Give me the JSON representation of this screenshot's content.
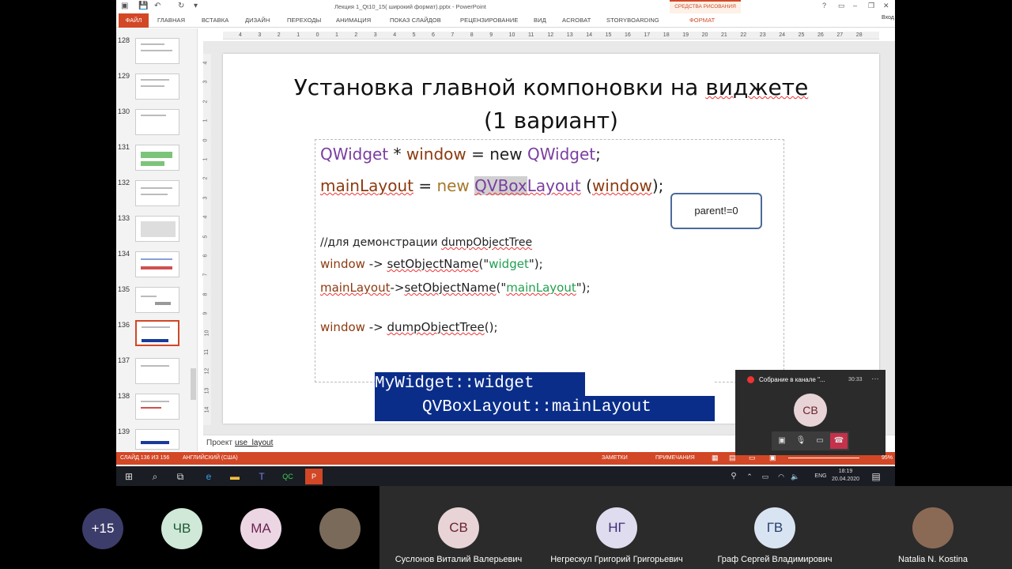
{
  "window": {
    "doc_title": "Лекция 1_Qt10_15( широкий формат).pptx - PowerPoint",
    "tools_header": "СРЕДСТВА РИСОВАНИЯ",
    "login": "Вход"
  },
  "ribbon": {
    "tabs": [
      "ФАЙЛ",
      "ГЛАВНАЯ",
      "ВСТАВКА",
      "ДИЗАЙН",
      "ПЕРЕХОДЫ",
      "АНИМАЦИЯ",
      "ПОКАЗ СЛАЙДОВ",
      "РЕЦЕНЗИРОВАНИЕ",
      "ВИД",
      "ACROBAT",
      "STORYBOARDING",
      "ФОРМАТ"
    ]
  },
  "ruler": {
    "numbers": [
      "4",
      "3",
      "2",
      "1",
      "0",
      "1",
      "2",
      "3",
      "4",
      "5",
      "6",
      "7",
      "8",
      "9",
      "10",
      "11",
      "12",
      "13",
      "14",
      "15",
      "16",
      "17",
      "18",
      "19",
      "20",
      "21",
      "22",
      "23",
      "24",
      "25",
      "26",
      "27",
      "28"
    ],
    "vnumbers": [
      "4",
      "3",
      "2",
      "1",
      "0",
      "1",
      "2",
      "3",
      "4",
      "5",
      "6",
      "7",
      "8",
      "9",
      "10",
      "11",
      "12",
      "13",
      "14"
    ]
  },
  "thumbnails": [
    {
      "num": "128"
    },
    {
      "num": "129"
    },
    {
      "num": "130"
    },
    {
      "num": "131"
    },
    {
      "num": "132"
    },
    {
      "num": "133"
    },
    {
      "num": "134"
    },
    {
      "num": "135"
    },
    {
      "num": "136"
    },
    {
      "num": "137"
    },
    {
      "num": "138"
    },
    {
      "num": "139"
    }
  ],
  "slide": {
    "title_part1": "Установка главной компоновки на ",
    "title_spell": "виджете",
    "title_line2": "(1 вариант)",
    "line1": {
      "a": "QWidget",
      "b": " * ",
      "c": "window",
      "d": " = new ",
      "e": "QWidget",
      "f": ";"
    },
    "line2": {
      "a": "mainLayout",
      "b": " =  ",
      "c": "new ",
      "d": "QVBox",
      "e": "Layout",
      "f": " (",
      "g": "window",
      "h": ");"
    },
    "callout": "parent!=0",
    "comment_a": "//для демонстрации ",
    "comment_b": "dumpObjectTree",
    "line3": {
      "a": "window",
      "b": " -> ",
      "c": "setObjectName",
      "d": "(\"",
      "e": "widget",
      "f": "\");"
    },
    "line4": {
      "a": "mainLayout",
      "b": "->",
      "c": "setObjectName",
      "d": "(\"",
      "e": "mainLayout",
      "f": "\");"
    },
    "line5": {
      "a": "window",
      "b": " -> ",
      "c": "dumpObjectTree",
      "d": "();"
    },
    "output_line1": "MyWidget::widget",
    "output_line2": "QVBoxLayout::mainLayout"
  },
  "notes": {
    "prefix": "Проект ",
    "link": "use_layout"
  },
  "status": {
    "slide": "СЛАЙД 136 ИЗ 156",
    "lang": "АНГЛИЙСКИЙ (США)",
    "notes": "ЗАМЕТКИ",
    "comments": "ПРИМЕЧАНИЯ",
    "zoom": "95%"
  },
  "taskbar": {
    "lang": "ENG",
    "time": "18:19",
    "date": "20.04.2020"
  },
  "mini_meeting": {
    "title": "Собрание в канале \"...",
    "time": "30:33",
    "avatar": "СВ"
  },
  "participants": [
    {
      "initials": "+15",
      "name": "",
      "bg": "#3d3d6b",
      "fg": "#ffffff"
    },
    {
      "initials": "ЧВ",
      "name": "",
      "bg": "#cfe8d8",
      "fg": "#1e5a36"
    },
    {
      "initials": "МА",
      "name": "",
      "bg": "#ecd6e4",
      "fg": "#6b2450"
    },
    {
      "initials": "",
      "name": "",
      "bg": "#7a6a5a",
      "fg": "#ffffff"
    },
    {
      "initials": "СВ",
      "name": "Суслонов Виталий Валерьевич",
      "bg": "#e8d3d6",
      "fg": "#6b2430"
    },
    {
      "initials": "НГ",
      "name": "Негрескул Григорий Григорьевич",
      "bg": "#e0dcef",
      "fg": "#3b2c73"
    },
    {
      "initials": "ГВ",
      "name": "Граф Сергей Владимирович",
      "bg": "#d9e4f2",
      "fg": "#243f6b"
    },
    {
      "initials": "",
      "name": "Natalia N. Kostina",
      "bg": "#8b6a55",
      "fg": "#ffffff"
    }
  ]
}
